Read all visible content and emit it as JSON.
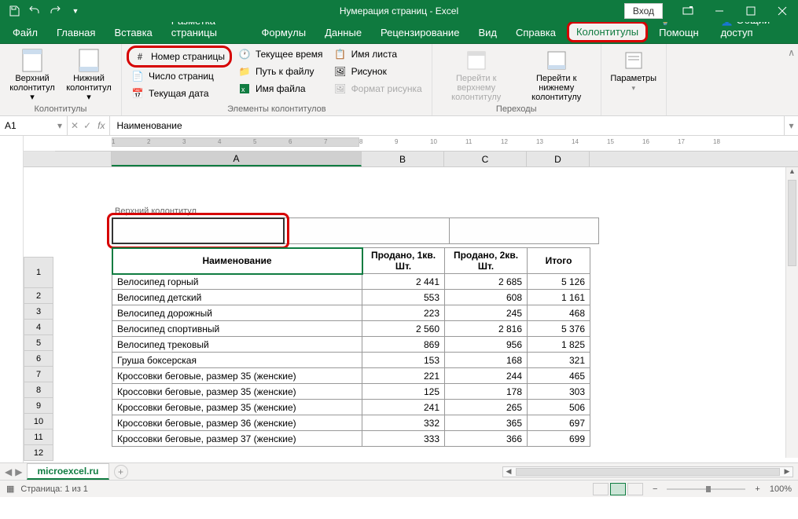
{
  "titlebar": {
    "title": "Нумерация страниц - Excel",
    "login": "Вход"
  },
  "tabs": {
    "file": "Файл",
    "home": "Главная",
    "insert": "Вставка",
    "layout": "Разметка страницы",
    "formulas": "Формулы",
    "data": "Данные",
    "review": "Рецензирование",
    "view": "Вид",
    "help": "Справка",
    "headerfooter": "Колонтитулы",
    "tell": "Помощн",
    "share_icon": "👤",
    "share": "Общий доступ"
  },
  "ribbon": {
    "group1": {
      "btn1": "Верхний колонтитул ▾",
      "btn2": "Нижний колонтитул ▾",
      "label": "Колонтитулы"
    },
    "group2": {
      "c1r1": "Номер страницы",
      "c1r2": "Число страниц",
      "c1r3": "Текущая дата",
      "c2r1": "Текущее время",
      "c2r2": "Путь к файлу",
      "c2r3": "Имя файла",
      "c3r1": "Имя листа",
      "c3r2": "Рисунок",
      "c3r3": "Формат рисунка",
      "label": "Элементы колонтитулов"
    },
    "group3": {
      "btn1": "Перейти к верхнему колонтитулу",
      "btn2": "Перейти к нижнему колонтитулу",
      "label": "Переходы"
    },
    "group4": {
      "btn1": "Параметры",
      "label": ""
    }
  },
  "formulabar": {
    "cell": "A1",
    "value": "Наименование"
  },
  "cols": {
    "a": "A",
    "b": "B",
    "c": "C",
    "d": "D"
  },
  "header_region": {
    "label": "Верхний колонтитул"
  },
  "table": {
    "headers": {
      "a": "Наименование",
      "b": "Продано, 1кв. Шт.",
      "c": "Продано, 2кв. Шт.",
      "d": "Итого"
    },
    "rows": [
      {
        "n": "1",
        "a": "Велосипед горный",
        "b": "2 441",
        "c": "2 685",
        "d": "5 126"
      },
      {
        "n": "2",
        "a": "Велосипед детский",
        "b": "553",
        "c": "608",
        "d": "1 161"
      },
      {
        "n": "3",
        "a": "Велосипед дорожный",
        "b": "223",
        "c": "245",
        "d": "468"
      },
      {
        "n": "4",
        "a": "Велосипед спортивный",
        "b": "2 560",
        "c": "2 816",
        "d": "5 376"
      },
      {
        "n": "5",
        "a": "Велосипед трековый",
        "b": "869",
        "c": "956",
        "d": "1 825"
      },
      {
        "n": "6",
        "a": "Груша боксерская",
        "b": "153",
        "c": "168",
        "d": "321"
      },
      {
        "n": "7",
        "a": "Кроссовки беговые, размер 35 (женские)",
        "b": "221",
        "c": "244",
        "d": "465"
      },
      {
        "n": "8",
        "a": "Кроссовки беговые, размер 35 (женские)",
        "b": "125",
        "c": "178",
        "d": "303"
      },
      {
        "n": "9",
        "a": "Кроссовки беговые, размер 35 (женские)",
        "b": "241",
        "c": "265",
        "d": "506"
      },
      {
        "n": "10",
        "a": "Кроссовки беговые, размер 36 (женские)",
        "b": "332",
        "c": "365",
        "d": "697"
      },
      {
        "n": "11",
        "a": "Кроссовки беговые, размер 37 (женские)",
        "b": "333",
        "c": "366",
        "d": "699"
      }
    ]
  },
  "sheettabs": {
    "name": "microexcel.ru"
  },
  "statusbar": {
    "page": "Страница: 1 из 1",
    "zoom": "100%"
  },
  "ruler": {
    "h": [
      "1",
      "2",
      "3",
      "4",
      "5",
      "6",
      "7",
      "8",
      "9",
      "10",
      "11",
      "12",
      "13",
      "14",
      "15",
      "16",
      "17",
      "18"
    ]
  }
}
